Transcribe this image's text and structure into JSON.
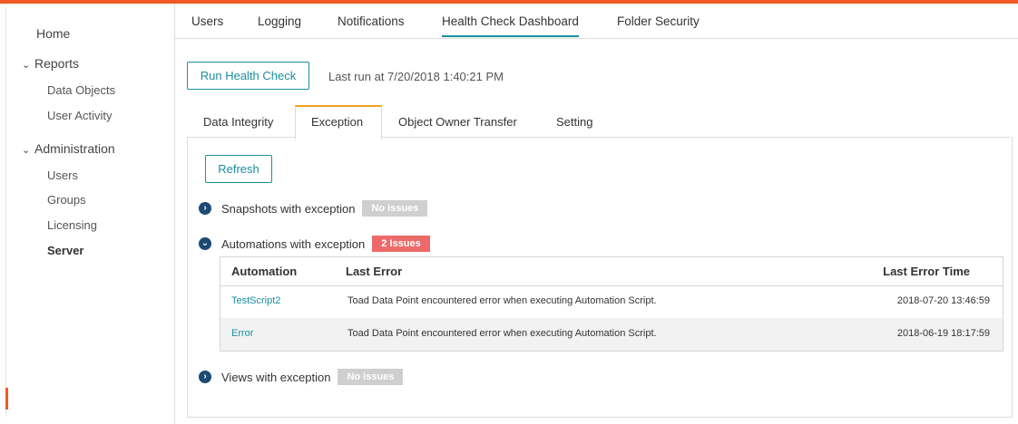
{
  "sidebar": {
    "home": "Home",
    "reports": {
      "label": "Reports",
      "items": [
        "Data Objects",
        "User Activity"
      ]
    },
    "administration": {
      "label": "Administration",
      "items": [
        "Users",
        "Groups",
        "Licensing",
        "Server"
      ]
    },
    "active_item": "Server"
  },
  "top_tabs": [
    "Users",
    "Logging",
    "Notifications",
    "Health Check Dashboard",
    "Folder Security"
  ],
  "active_top_tab": "Health Check Dashboard",
  "run_health_check_label": "Run Health Check",
  "last_run_text": "Last run at 7/20/2018 1:40:21 PM",
  "sub_tabs": [
    "Data Integrity",
    "Exception",
    "Object Owner Transfer",
    "Setting"
  ],
  "active_sub_tab": "Exception",
  "refresh_label": "Refresh",
  "sections": [
    {
      "label": "Snapshots with exception",
      "badge": "No issues",
      "status": "ok",
      "expanded": false
    },
    {
      "label": "Automations with exception",
      "badge": "2 Issues",
      "status": "issue",
      "expanded": true
    },
    {
      "label": "Views with exception",
      "badge": "No issues",
      "status": "ok",
      "expanded": false
    }
  ],
  "table": {
    "headers": [
      "Automation",
      "Last Error",
      "Last Error Time"
    ],
    "rows": [
      {
        "automation": "TestScript2",
        "last_error": "Toad Data Point encountered error when executing Automation Script.",
        "time": "2018-07-20 13:46:59"
      },
      {
        "automation": "Error",
        "last_error": "Toad Data Point encountered error when executing Automation Script.",
        "time": "2018-06-19 18:17:59"
      }
    ]
  },
  "colors": {
    "accent": "#1a8fa0",
    "brand_orange": "#f05a22",
    "issue_red": "#ec6a6a",
    "neutral_badge": "#cfcfcf",
    "expander": "#1c4a72"
  }
}
